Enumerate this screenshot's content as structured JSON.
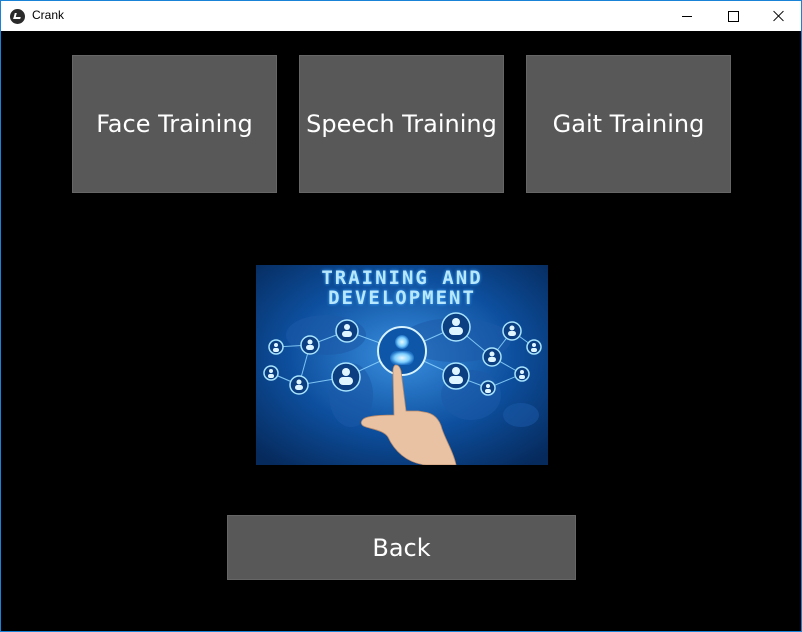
{
  "window": {
    "title": "Crank",
    "controls": [
      "minimize-icon",
      "maximize-icon",
      "close-icon"
    ]
  },
  "buttons": {
    "face_training": "Face Training",
    "speech_training": "Speech Training",
    "gait_training": "Gait Training",
    "back": "Back"
  },
  "image": {
    "line1": "TRAINING AND",
    "line2": "DEVELOPMENT"
  },
  "colors": {
    "background": "#000000",
    "button": "#585858",
    "button_text": "#ffffff",
    "window_border": "#1883d7"
  }
}
